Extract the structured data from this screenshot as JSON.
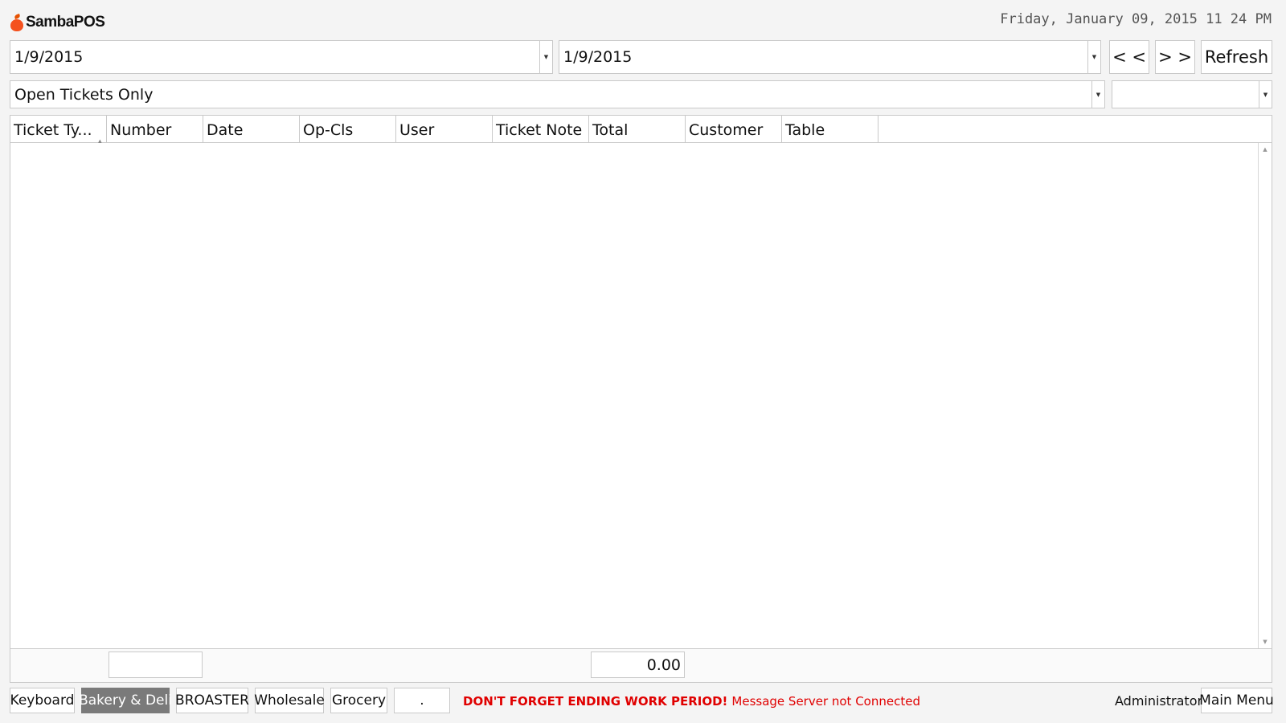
{
  "app": {
    "name": "SambaPOS"
  },
  "clock": "Friday, January 09, 2015 11 24 PM",
  "filters": {
    "start_date": "1/9/2015",
    "end_date": "1/9/2015",
    "prev_label": "< <",
    "next_label": "> >",
    "refresh_label": "Refresh",
    "status": "Open Tickets Only",
    "secondary": ""
  },
  "grid": {
    "columns": [
      "Ticket Ty...",
      "Number",
      "Date",
      "Op-Cls",
      "User",
      "Ticket Note",
      "Total",
      "Customer",
      "Table"
    ],
    "rows": []
  },
  "totals": {
    "number": "",
    "total": "0.00"
  },
  "tabs": [
    {
      "label": "Keyboard",
      "active": false
    },
    {
      "label": "Bakery & Deli",
      "active": true
    },
    {
      "label": "BROASTER",
      "active": false
    },
    {
      "label": "Wholesale",
      "active": false
    },
    {
      "label": "Grocery",
      "active": false
    },
    {
      "label": ".",
      "active": false
    }
  ],
  "status": {
    "warning": "DON'T FORGET ENDING WORK PERIOD!",
    "message": "Message Server not Connected"
  },
  "user": "Administrator",
  "main_menu_label": "Main Menu"
}
